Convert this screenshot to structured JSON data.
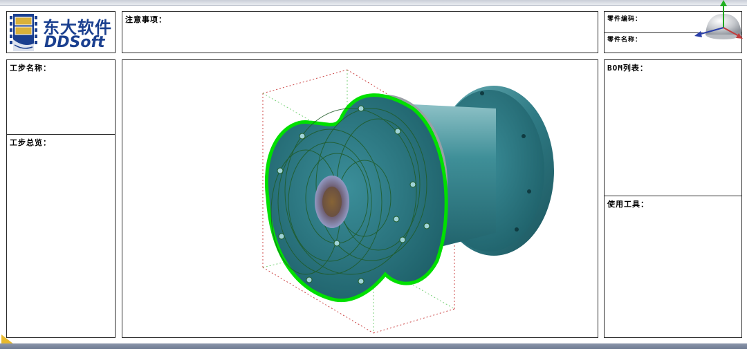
{
  "logo": {
    "cn": "东大软件",
    "en": "DDSoft"
  },
  "notes": {
    "label": "注意事项："
  },
  "part": {
    "code_label": "零件编码：",
    "name_label": "零件名称："
  },
  "step": {
    "name_label": "工步名称：",
    "overview_label": "工步总览："
  },
  "bom": {
    "label": "BOM列表：",
    "tools_label": "使用工具："
  },
  "colors": {
    "model": "#2f7b85",
    "highlight": "#00e000",
    "logo": "#1a3f8f"
  },
  "icons": [
    "film-logo-icon",
    "view-triad-icon",
    "corner-marker-icon"
  ]
}
